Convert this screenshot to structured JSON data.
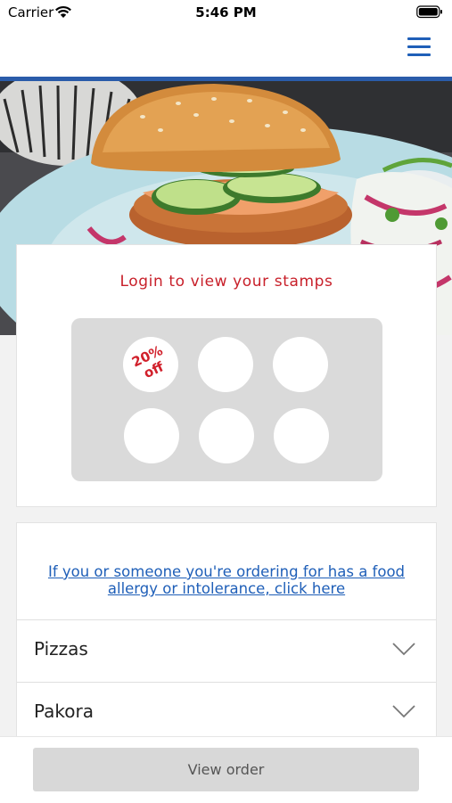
{
  "status_bar": {
    "carrier": "Carrier",
    "time": "5:46 PM"
  },
  "nav": {
    "menu_icon": "hamburger-menu-icon",
    "accent": "#1f5fb8"
  },
  "hero": {
    "image": "burger-photo"
  },
  "stamp_card": {
    "title": "Login to view your stamps",
    "title_color": "#c8202a",
    "stamps": [
      {
        "reward_line1": "20%",
        "reward_line2": "off"
      },
      {},
      {},
      {},
      {},
      {}
    ]
  },
  "menu": {
    "allergy_link_line1": "If you or someone you're ordering for has a food",
    "allergy_link_line2": "allergy or intolerance, click here",
    "categories": [
      {
        "label": "Pizzas",
        "icon": "chevron-down-icon"
      },
      {
        "label": "Pakora",
        "icon": "chevron-down-icon"
      }
    ]
  },
  "footer": {
    "view_order_label": "View order"
  }
}
